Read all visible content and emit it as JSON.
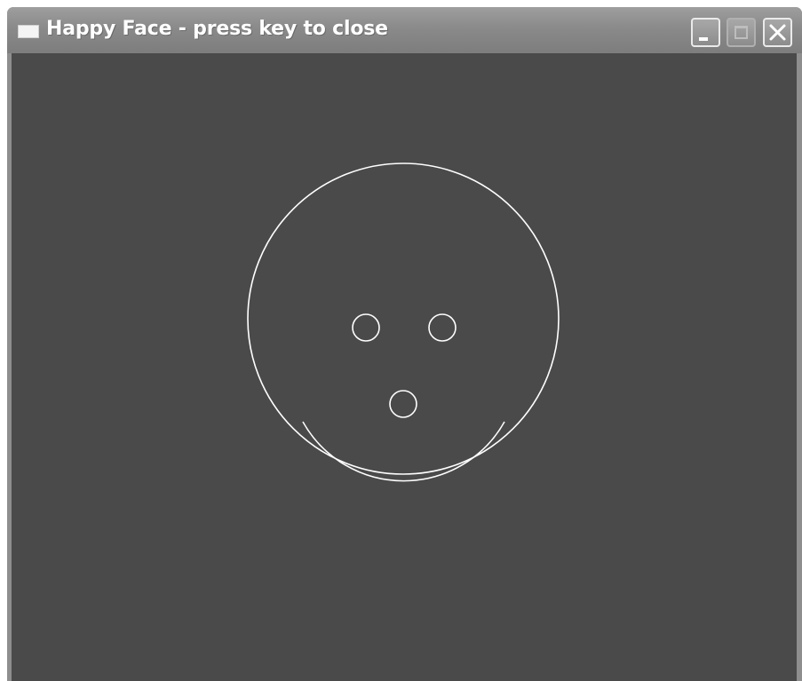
{
  "window": {
    "title": "Happy Face - press key to close",
    "icon": "app-window-icon",
    "controls": {
      "minimize_icon": "minimize-icon",
      "maximize_icon": "maximize-icon",
      "close_icon": "close-icon",
      "maximize_enabled": false
    }
  },
  "colors": {
    "client_background": "#4a4a4b",
    "stroke": "#ffffff",
    "title_bar": "#8a8a8a"
  },
  "drawing": {
    "shapes": [
      "face-outline",
      "left-eye",
      "right-eye",
      "nose",
      "smile-arc"
    ]
  }
}
